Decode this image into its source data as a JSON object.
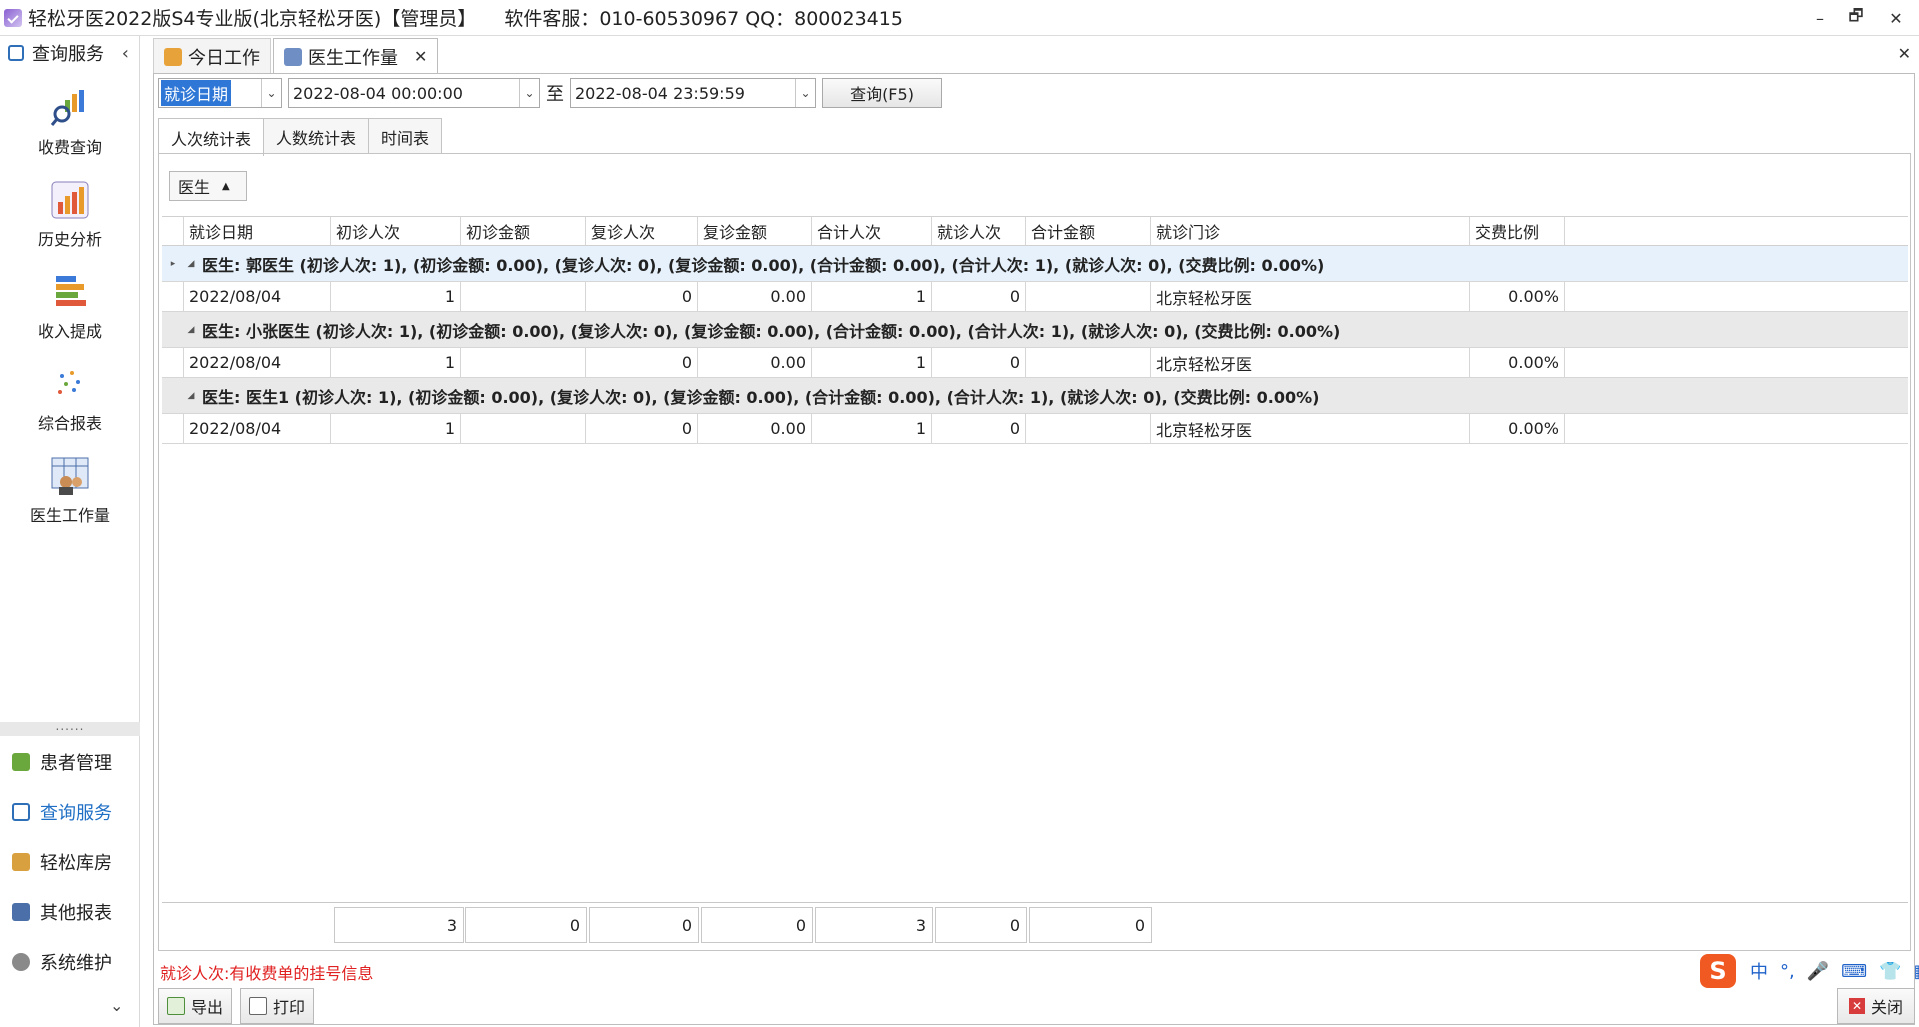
{
  "window": {
    "title": "轻松牙医2022版S4专业版(北京轻松牙医)【管理员】",
    "service": "软件客服：010-60530967 QQ：800023415",
    "min": "–",
    "restore": "🗗",
    "close": "✕"
  },
  "sidebar": {
    "header": "查询服务",
    "collapse": "‹",
    "items": [
      {
        "label": "收费查询",
        "icon": "charge-query-icon"
      },
      {
        "label": "历史分析",
        "icon": "history-analysis-icon"
      },
      {
        "label": "收入提成",
        "icon": "income-commission-icon"
      },
      {
        "label": "综合报表",
        "icon": "comprehensive-report-icon"
      },
      {
        "label": "医生工作量",
        "icon": "doctor-workload-icon"
      }
    ],
    "grip": "......",
    "nav": [
      {
        "label": "患者管理",
        "icon": "patients-icon"
      },
      {
        "label": "查询服务",
        "icon": "query-service-icon",
        "active": true
      },
      {
        "label": "轻松库房",
        "icon": "warehouse-icon"
      },
      {
        "label": "其他报表",
        "icon": "other-reports-icon"
      },
      {
        "label": "系统维护",
        "icon": "maintenance-icon"
      }
    ],
    "down": "⌄"
  },
  "tabs": {
    "items": [
      {
        "label": "今日工作"
      },
      {
        "label": "医生工作量",
        "closable": "✕"
      }
    ],
    "close_all": "✕"
  },
  "query": {
    "date_type": "就诊日期",
    "start": "2022-08-04 00:00:00",
    "to": "至",
    "end": "2022-08-04 23:59:59",
    "button": "查询(F5)"
  },
  "subtabs": [
    "人次统计表",
    "人数统计表",
    "时间表"
  ],
  "group_chip": {
    "label": "医生",
    "sort": "▲"
  },
  "grid": {
    "columns": [
      "就诊日期",
      "初诊人次",
      "初诊金额",
      "复诊人次",
      "复诊金额",
      "合计人次",
      "就诊人次",
      "合计金额",
      "就诊门诊",
      "交费比例"
    ],
    "groups": [
      {
        "summary": "医生: 郭医生 (初诊人次: 1), (初诊金额: 0.00), (复诊人次: 0), (复诊金额: 0.00), (合计金额: 0.00), (合计人次: 1), (就诊人次: 0), (交费比例: 0.00%)",
        "row": [
          "2022/08/04",
          "1",
          "",
          "0",
          "0.00",
          "1",
          "0",
          "",
          "北京轻松牙医",
          "0.00%"
        ]
      },
      {
        "summary": "医生: 小张医生 (初诊人次: 1), (初诊金额: 0.00), (复诊人次: 0), (复诊金额: 0.00), (合计金额: 0.00), (合计人次: 1), (就诊人次: 0), (交费比例: 0.00%)",
        "row": [
          "2022/08/04",
          "1",
          "",
          "0",
          "0.00",
          "1",
          "0",
          "",
          "北京轻松牙医",
          "0.00%"
        ]
      },
      {
        "summary": "医生: 医生1 (初诊人次: 1), (初诊金额: 0.00), (复诊人次: 0), (复诊金额: 0.00), (合计金额: 0.00), (合计人次: 1), (就诊人次: 0), (交费比例: 0.00%)",
        "row": [
          "2022/08/04",
          "1",
          "",
          "0",
          "0.00",
          "1",
          "0",
          "",
          "北京轻松牙医",
          "0.00%"
        ]
      }
    ],
    "totals": [
      "3",
      "0",
      "0",
      "0",
      "3",
      "0",
      "0"
    ]
  },
  "note": "就诊人次:有收费单的挂号信息",
  "bottom": {
    "export": "导出",
    "print": "打印",
    "close": "关闭"
  },
  "ime": {
    "logo": "S",
    "lang": "中",
    "punct": "°,"
  },
  "colors": {
    "accent": "#2f77d6",
    "note": "#e02020",
    "group_focus": "#e6f1fb",
    "group_bg": "#e9e9e9"
  }
}
